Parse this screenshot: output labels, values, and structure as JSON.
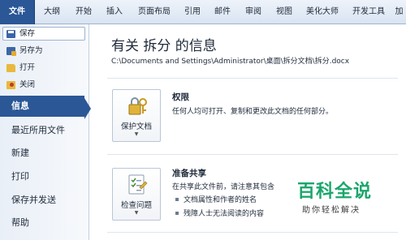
{
  "ribbon": {
    "tabs": [
      "文件",
      "大纲",
      "开始",
      "插入",
      "页面布局",
      "引用",
      "邮件",
      "审阅",
      "视图",
      "美化大师",
      "开发工具",
      "加"
    ]
  },
  "sidebar": {
    "quick": [
      {
        "label": "保存",
        "icon": "save-icon"
      },
      {
        "label": "另存为",
        "icon": "save-as-icon"
      },
      {
        "label": "打开",
        "icon": "open-folder-icon"
      },
      {
        "label": "关闭",
        "icon": "close-document-icon"
      }
    ],
    "sections": [
      "信息",
      "最近所用文件",
      "新建",
      "打印",
      "保存并发送",
      "帮助"
    ],
    "active_section": "信息"
  },
  "main": {
    "title": "有关 拆分 的信息",
    "path": "C:\\Documents and Settings\\Administrator\\桌面\\拆分文档\\拆分.docx",
    "permissions": {
      "button_label": "保护文档",
      "button_icon": "key-lock-icon",
      "heading": "权限",
      "description": "任何人均可打开、复制和更改此文档的任何部分。"
    },
    "prepare": {
      "button_label": "检查问题",
      "button_icon": "checklist-icon",
      "heading": "准备共享",
      "description": "在共享此文件前，请注意其包含",
      "bullets": [
        "文档属性和作者的姓名",
        "残障人士无法阅读的内容"
      ]
    }
  },
  "watermark": {
    "line1": "百科全说",
    "line2": "助你轻松解决"
  },
  "colors": {
    "accent": "#2b5797",
    "watermark_green": "#1aa66c"
  }
}
